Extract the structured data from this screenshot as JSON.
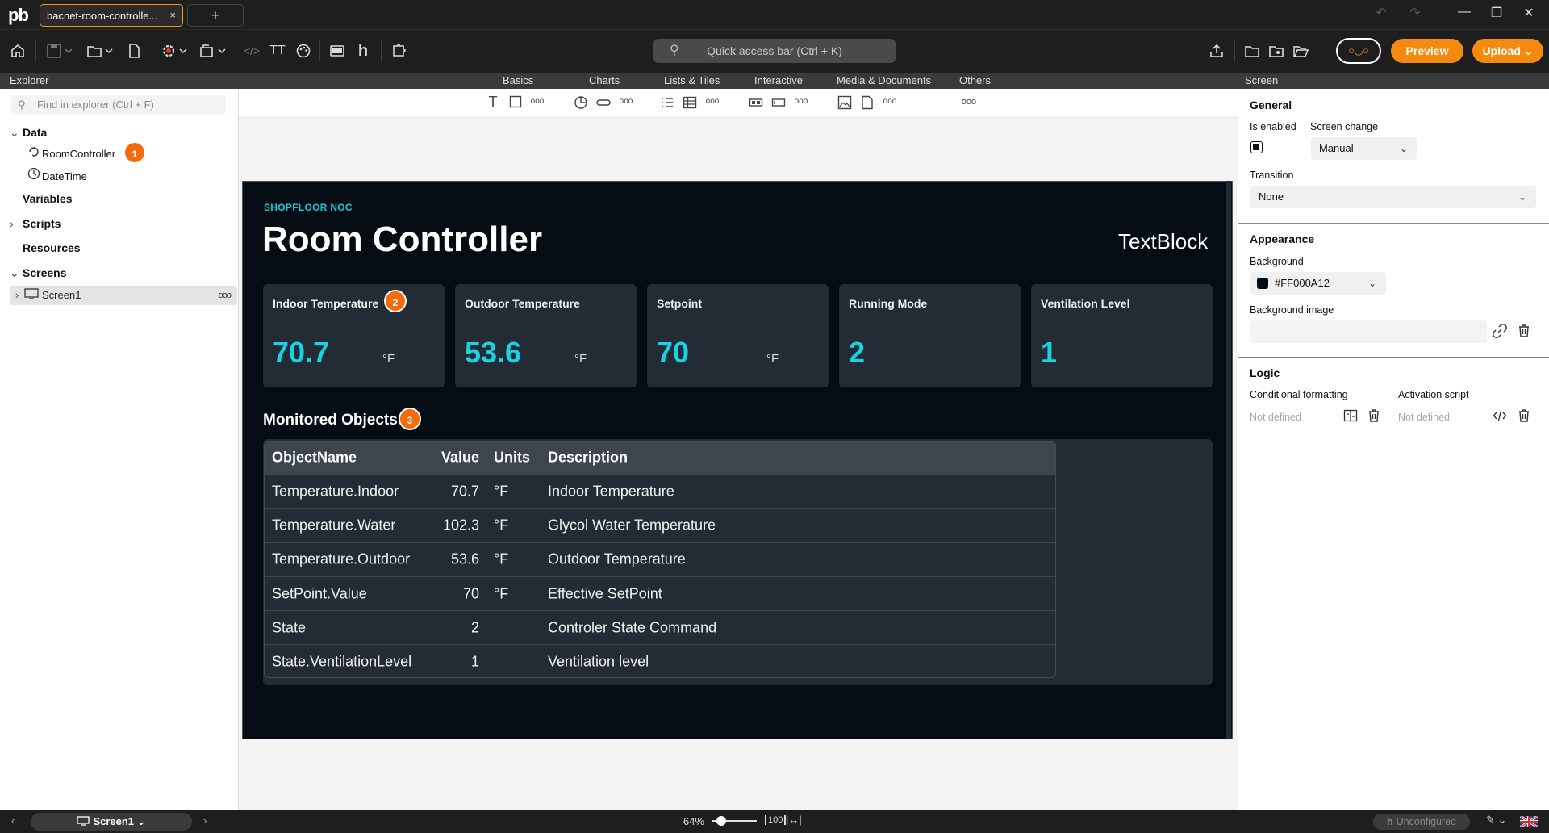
{
  "app": {
    "logo": "pb",
    "tab_title": "bacnet-room-controlle...",
    "tab_close": "×",
    "new_tab": "+",
    "window_controls": {
      "undo": "↶",
      "redo": "↷",
      "minimize": "—",
      "restore": "❐",
      "close": "✕"
    }
  },
  "toolbar": {
    "quick_access_placeholder": "Quick access bar (Ctrl + K)",
    "bot_label": "○◡○",
    "preview_label": "Preview",
    "upload_label": "Upload",
    "upload_chevron": "⌄",
    "text_icon_glyph": "TT",
    "code_icon_glyph": "</>",
    "h_icon_glyph": "h"
  },
  "header_strip": {
    "explorer": "Explorer",
    "categories": [
      "Basics",
      "Charts",
      "Lists & Tiles",
      "Interactive",
      "Media & Documents",
      "Others"
    ],
    "screen": "Screen"
  },
  "explorer": {
    "search_placeholder": "Find in explorer (Ctrl + F)",
    "sections": {
      "data": "Data",
      "variables": "Variables",
      "scripts": "Scripts",
      "resources": "Resources",
      "screens": "Screens"
    },
    "data_items": [
      "RoomController",
      "DateTime"
    ],
    "screen_items": [
      "Screen1"
    ],
    "more": "ooo"
  },
  "badges": [
    "1",
    "2",
    "3"
  ],
  "canvas": {
    "eyebrow": "SHOPFLOOR NOC",
    "title": "Room Controller",
    "textblock": "TextBlock",
    "cards": [
      {
        "label": "Indoor Temperature",
        "value": "70.7",
        "unit": "°F"
      },
      {
        "label": "Outdoor Temperature",
        "value": "53.6",
        "unit": "°F"
      },
      {
        "label": "Setpoint",
        "value": "70",
        "unit": "°F"
      },
      {
        "label": "Running Mode",
        "value": "2",
        "unit": ""
      },
      {
        "label": "Ventilation Level",
        "value": "1",
        "unit": ""
      }
    ],
    "monitored_title": "Monitored Objects",
    "table": {
      "headers": [
        "ObjectName",
        "Value",
        "Units",
        "Description"
      ],
      "rows": [
        [
          "Temperature.Indoor",
          "70.7",
          "°F",
          "Indoor Temperature"
        ],
        [
          "Temperature.Water",
          "102.3",
          "°F",
          "Glycol Water Temperature"
        ],
        [
          "Temperature.Outdoor",
          "53.6",
          "°F",
          "Outdoor Temperature"
        ],
        [
          "SetPoint.Value",
          "70",
          "°F",
          "Effective SetPoint"
        ],
        [
          "State",
          "2",
          "",
          "Controler State Command"
        ],
        [
          "State.VentilationLevel",
          "1",
          "",
          "Ventilation level"
        ]
      ]
    }
  },
  "props": {
    "general": "General",
    "is_enabled": "Is enabled",
    "screen_change": "Screen change",
    "screen_change_value": "Manual",
    "transition": "Transition",
    "transition_value": "None",
    "appearance": "Appearance",
    "background": "Background",
    "background_value": "#FF000A12",
    "background_swatch": "#000a12",
    "background_image": "Background image",
    "logic": "Logic",
    "conditional_formatting": "Conditional formatting",
    "activation_script": "Activation script",
    "not_defined": "Not defined"
  },
  "statusbar": {
    "screen": "Screen1",
    "zoom": "64%",
    "fit_label": "100",
    "unconfigured": "Unconfigured"
  },
  "colors": {
    "accent_orange": "#f58a0e",
    "cyan_value": "#17d3e3",
    "dark_bg": "#050c14",
    "card_bg": "#232c34"
  }
}
